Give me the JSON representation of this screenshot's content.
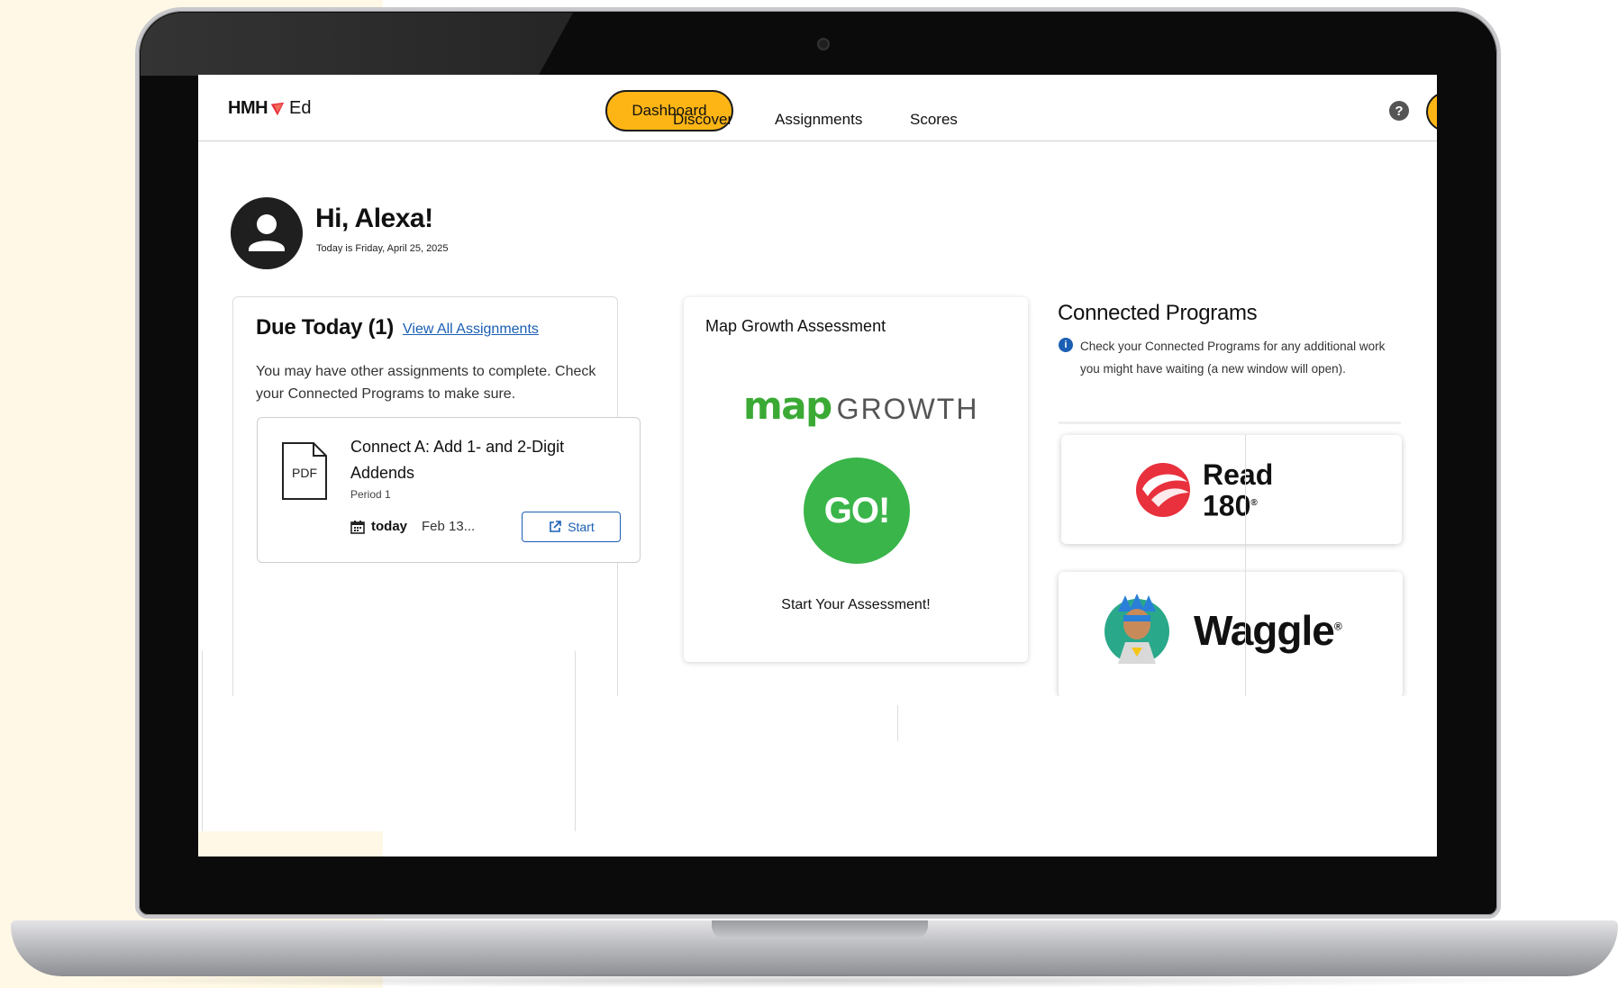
{
  "nav": {
    "logo_hmh": "HMH",
    "logo_ed": "Ed",
    "tabs": [
      {
        "label": "Dashboard",
        "active": true
      },
      {
        "label": "Discover"
      },
      {
        "label": "Assignments"
      },
      {
        "label": "Scores"
      }
    ],
    "help_glyph": "?"
  },
  "greeting": {
    "title": "Hi, Alexa!",
    "date": "Today is Friday, April 25, 2025"
  },
  "due_today": {
    "title": "Due Today (1)",
    "view_all_link": "View All Assignments",
    "message": "You may have other assignments to complete. Check your Connected Programs to make sure.",
    "assignment": {
      "file_type": "PDF",
      "title": "Connect A: Add 1- and 2-Digit Addends",
      "period": "Period 1",
      "due_when": "today",
      "due_date": "Feb 13...",
      "start_label": "Start"
    }
  },
  "map_growth": {
    "title": "Map Growth Assessment",
    "logo_map": "map",
    "logo_growth": "GROWTH",
    "go_label": "GO!",
    "cta": "Start Your Assessment!"
  },
  "connected_programs": {
    "title": "Connected Programs",
    "info": "Check your Connected Programs for any additional work you might have waiting (a new window will open).",
    "programs": [
      {
        "name_line1": "Read",
        "name_line2": "180",
        "mark": "®"
      },
      {
        "name": "Waggle",
        "mark": "®"
      }
    ]
  },
  "colors": {
    "accent_yellow": "#fdb515",
    "link_blue": "#1a5fb4",
    "go_green": "#3ab54a",
    "read180_red": "#e8313d"
  }
}
